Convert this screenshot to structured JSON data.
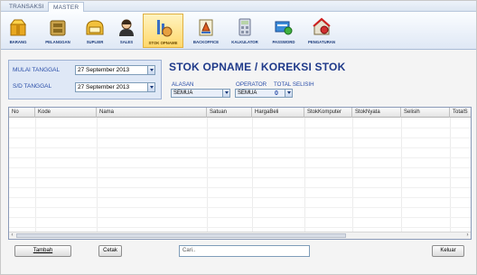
{
  "ribbon": {
    "tabs": [
      "TRANSAKSI",
      "MASTER"
    ],
    "buttons": [
      {
        "label": "BARANG",
        "icon": "box-icon"
      },
      {
        "label": "PELANGGAN",
        "icon": "customer-icon"
      },
      {
        "label": "SUPLIER",
        "icon": "supplier-icon"
      },
      {
        "label": "SALES",
        "icon": "sales-person-icon"
      },
      {
        "label": "STOK OPNAME",
        "icon": "stock-opname-icon"
      },
      {
        "label": "BACKOFFICE",
        "icon": "backoffice-icon"
      },
      {
        "label": "KALKULATOR",
        "icon": "calculator-icon"
      },
      {
        "label": "PASSWORD",
        "icon": "password-icon"
      },
      {
        "label": "PENGATURAN",
        "icon": "settings-icon"
      }
    ]
  },
  "filter": {
    "mulai_label": "MULAI TANGGAL",
    "mulai_value": "27 September 2013",
    "sd_label": "S/D TANGGAL",
    "sd_value": "27 September 2013"
  },
  "title": "STOK OPNAME / KOREKSI STOK",
  "alasan": {
    "label": "ALASAN",
    "value": "SEMUA"
  },
  "operator": {
    "label": "OPERATOR",
    "value": "SEMUA"
  },
  "total_selisih": {
    "label": "TOTAL SELISIH",
    "value": "0"
  },
  "grid": {
    "columns": [
      "No",
      "Kode",
      "Nama",
      "Satuan",
      "HargaBeli",
      "StokKomputer",
      "StokNyata",
      "Selisih",
      "TotalS"
    ]
  },
  "footer": {
    "tambah_label": "Tambah",
    "cetak_label": "Cetak",
    "search_placeholder": "Cari..",
    "keluar_label": "Keluar"
  },
  "colors": {
    "accent": "#1f3a8a",
    "label_blue": "#2a4ea8",
    "active_tab": "#ffd86b"
  }
}
